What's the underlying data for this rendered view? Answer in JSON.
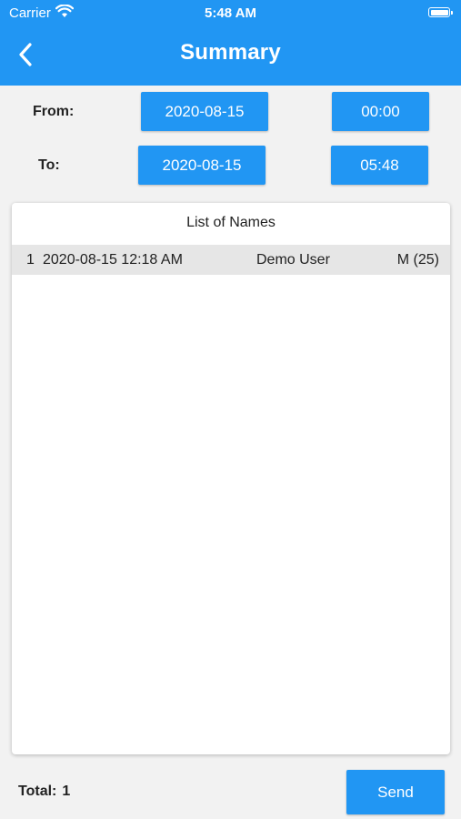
{
  "status_bar": {
    "carrier": "Carrier",
    "time": "5:48 AM"
  },
  "header": {
    "title": "Summary"
  },
  "filters": {
    "from_label": "From:",
    "from_date": "2020-08-15",
    "from_time": "00:00",
    "to_label": "To:",
    "to_date": "2020-08-15",
    "to_time": "05:48"
  },
  "list": {
    "title": "List of Names",
    "rows": [
      {
        "index": "1",
        "datetime": "2020-08-15 12:18 AM",
        "name": "Demo User",
        "info": "M (25)"
      }
    ]
  },
  "footer": {
    "total_label": "Total:",
    "total_value": "1",
    "send_label": "Send"
  },
  "colors": {
    "accent": "#2196f3",
    "row_bg": "#e6e6e6",
    "background": "#f2f2f2"
  }
}
